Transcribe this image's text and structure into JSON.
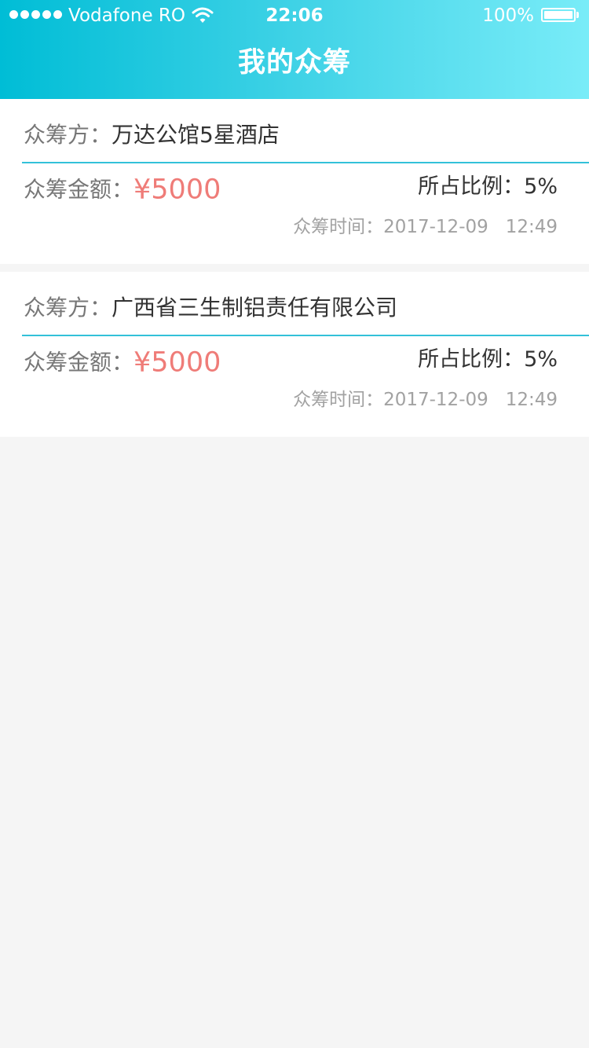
{
  "status_bar": {
    "carrier": "Vodafone RO",
    "time": "22:06",
    "battery": "100%",
    "icons": [
      "signal-dots-icon",
      "wifi-icon",
      "battery-icon"
    ]
  },
  "nav": {
    "title": "我的众筹"
  },
  "list": [
    {
      "party_label": "众筹方：",
      "party": "万达公馆5星酒店",
      "amount_label": "众筹金额：",
      "amount": "¥5000",
      "ratio_label": "所占比例：",
      "ratio": "5%",
      "time_label": "众筹时间：",
      "date": "2017-12-09",
      "clock": "12:49"
    },
    {
      "party_label": "众筹方：",
      "party": "广西省三生制铝责任有限公司",
      "amount_label": "众筹金额：",
      "amount": "¥5000",
      "ratio_label": "所占比例：",
      "ratio": "5%",
      "time_label": "众筹时间：",
      "date": "2017-12-09",
      "clock": "12:49"
    }
  ],
  "colors": {
    "header_start": "#00bdd6",
    "header_end": "#79ecf8",
    "divider": "#33c1d9",
    "amount": "#ef7c78",
    "background": "#f5f5f5"
  }
}
